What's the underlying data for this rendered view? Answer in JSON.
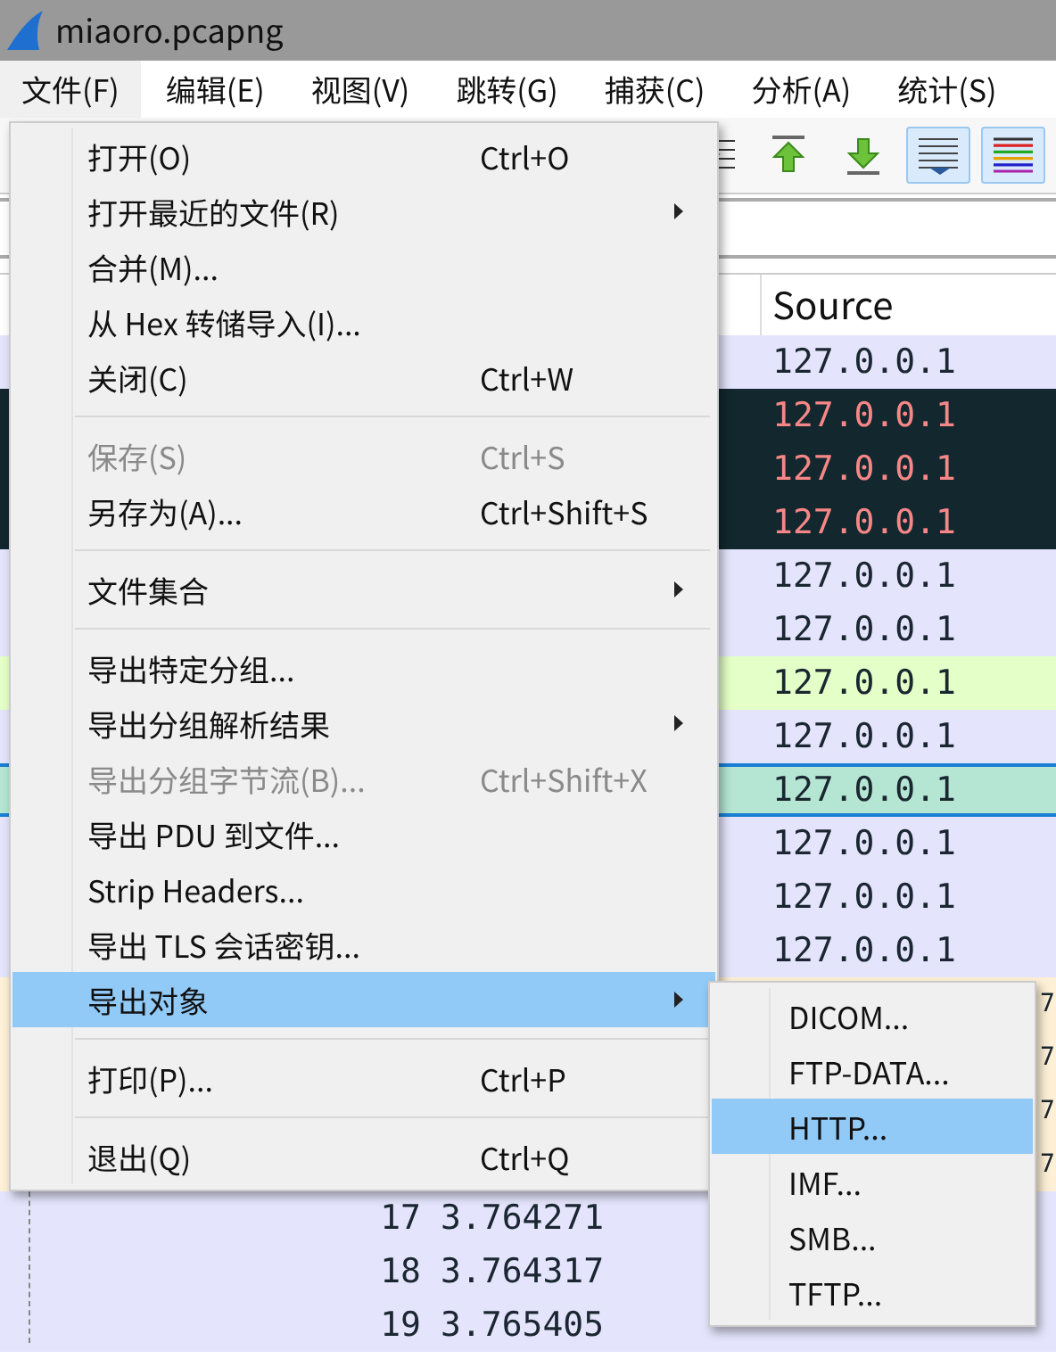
{
  "window": {
    "title": "miaoro.pcapng"
  },
  "menubar": [
    {
      "label": "文件(F)",
      "selected": true
    },
    {
      "label": "编辑(E)",
      "selected": false
    },
    {
      "label": "视图(V)",
      "selected": false
    },
    {
      "label": "跳转(G)",
      "selected": false
    },
    {
      "label": "捕获(C)",
      "selected": false
    },
    {
      "label": "分析(A)",
      "selected": false
    },
    {
      "label": "统计(S)",
      "selected": false
    }
  ],
  "toolbar": [
    {
      "kind": "goto",
      "on": false
    },
    {
      "kind": "first",
      "on": false
    },
    {
      "kind": "last",
      "on": false
    },
    {
      "kind": "autoscroll",
      "on": true
    },
    {
      "kind": "colorize",
      "on": true
    }
  ],
  "packet_list": {
    "columns": [
      "Source"
    ],
    "rows": [
      {
        "source": "127.0.0.1",
        "color": "#e4e4fc",
        "selected": false
      },
      {
        "source": "127.0.0.1",
        "color": "#12272e",
        "selected": false
      },
      {
        "source": "127.0.0.1",
        "color": "#12272e",
        "selected": false
      },
      {
        "source": "127.0.0.1",
        "color": "#12272e",
        "selected": false
      },
      {
        "source": "127.0.0.1",
        "color": "#e4e4fc",
        "selected": false
      },
      {
        "source": "127.0.0.1",
        "color": "#e4e4fc",
        "selected": false
      },
      {
        "source": "127.0.0.1",
        "color": "#e4ffc7",
        "selected": false
      },
      {
        "source": "127.0.0.1",
        "color": "#e4e4fc",
        "selected": false
      },
      {
        "source": "127.0.0.1",
        "color": "#b5e6d3",
        "selected": true
      },
      {
        "source": "127.0.0.1",
        "color": "#e4e4fc",
        "selected": false
      },
      {
        "source": "127.0.0.1",
        "color": "#e4e4fc",
        "selected": false
      },
      {
        "source": "127.0.0.1",
        "color": "#e4e4fc",
        "selected": false
      },
      {
        "column_4": "7",
        "color": "#fdf0d6",
        "selected": false
      },
      {
        "column_4": "7",
        "color": "#fdf0d6",
        "selected": false
      },
      {
        "column_4": "7",
        "color": "#fdf0d6",
        "selected": false
      },
      {
        "column_4": "7",
        "color": "#fdf0d6",
        "selected": false
      },
      {
        "no": "17",
        "time": "3.764271",
        "color": "#e4e4fc",
        "selected": false
      },
      {
        "no": "18",
        "time": "3.764317",
        "color": "#e4e4fc",
        "selected": false
      },
      {
        "no": "19",
        "time": "3.765405",
        "color": "#e4e4fc",
        "selected": false
      }
    ]
  },
  "file_menu": [
    {
      "kind": "item",
      "label": "打开(O)",
      "shortcut": "Ctrl+O",
      "submenu": false,
      "disabled": false,
      "selected": false
    },
    {
      "kind": "item",
      "label": "打开最近的文件(R)",
      "submenu": true,
      "disabled": false,
      "selected": false
    },
    {
      "kind": "item",
      "label": "合并(M)...",
      "submenu": false,
      "disabled": false,
      "selected": false
    },
    {
      "kind": "item",
      "label": "从 Hex 转储导入(I)...",
      "submenu": false,
      "disabled": false,
      "selected": false
    },
    {
      "kind": "item",
      "label": "关闭(C)",
      "shortcut": "Ctrl+W",
      "submenu": false,
      "disabled": false,
      "selected": false
    },
    {
      "kind": "separator"
    },
    {
      "kind": "item",
      "label": "保存(S)",
      "shortcut": "Ctrl+S",
      "submenu": false,
      "disabled": true,
      "selected": false
    },
    {
      "kind": "item",
      "label": "另存为(A)...",
      "shortcut": "Ctrl+Shift+S",
      "submenu": false,
      "disabled": false,
      "selected": false
    },
    {
      "kind": "separator"
    },
    {
      "kind": "item",
      "label": "文件集合",
      "submenu": true,
      "disabled": false,
      "selected": false
    },
    {
      "kind": "separator"
    },
    {
      "kind": "item",
      "label": "导出特定分组...",
      "submenu": false,
      "disabled": false,
      "selected": false
    },
    {
      "kind": "item",
      "label": "导出分组解析结果",
      "submenu": true,
      "disabled": false,
      "selected": false
    },
    {
      "kind": "item",
      "label": "导出分组字节流(B)...",
      "shortcut": "Ctrl+Shift+X",
      "submenu": false,
      "disabled": true,
      "selected": false
    },
    {
      "kind": "item",
      "label": "导出 PDU 到文件...",
      "submenu": false,
      "disabled": false,
      "selected": false
    },
    {
      "kind": "item",
      "label": "Strip Headers...",
      "submenu": false,
      "disabled": false,
      "selected": false
    },
    {
      "kind": "item",
      "label": "导出 TLS 会话密钥...",
      "submenu": false,
      "disabled": false,
      "selected": false
    },
    {
      "kind": "item",
      "label": "导出对象",
      "submenu": true,
      "disabled": false,
      "selected": true
    },
    {
      "kind": "separator"
    },
    {
      "kind": "item",
      "label": "打印(P)...",
      "shortcut": "Ctrl+P",
      "submenu": false,
      "disabled": false,
      "selected": false
    },
    {
      "kind": "separator"
    },
    {
      "kind": "item",
      "label": "退出(Q)",
      "shortcut": "Ctrl+Q",
      "submenu": false,
      "disabled": false,
      "selected": false
    }
  ],
  "export_objects_menu": [
    {
      "label": "DICOM...",
      "selected": false
    },
    {
      "label": "FTP-DATA...",
      "selected": false
    },
    {
      "label": "HTTP...",
      "selected": true
    },
    {
      "label": "IMF...",
      "selected": false
    },
    {
      "label": "SMB...",
      "selected": false
    },
    {
      "label": "TFTP...",
      "selected": false
    }
  ]
}
